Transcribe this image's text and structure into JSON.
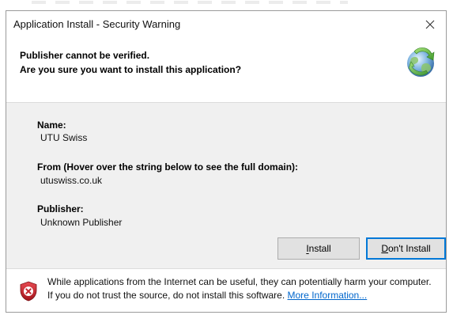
{
  "window": {
    "title": "Application Install - Security Warning",
    "close_glyph": "✕"
  },
  "header": {
    "line1": "Publisher cannot be verified.",
    "line2": "Are you sure you want to install this application?",
    "icon": "globe-install-icon"
  },
  "details": {
    "name_label": "Name:",
    "name_value": "UTU Swiss",
    "from_label": "From (Hover over the string below to see the full domain):",
    "from_value": "utuswiss.co.uk",
    "publisher_label": "Publisher:",
    "publisher_value": "Unknown Publisher"
  },
  "buttons": {
    "install_label": "Install",
    "dont_install_label": "Don't Install"
  },
  "footer": {
    "icon": "shield-warning-icon",
    "text": "While applications from the Internet can be useful, they can potentially harm your computer. If you do not trust the source, do not install this software.",
    "link_text": "More Information..."
  },
  "colors": {
    "accent": "#0078d7",
    "link": "#0066cc",
    "panel": "#f0f0f0",
    "shield_red": "#c4262e"
  }
}
